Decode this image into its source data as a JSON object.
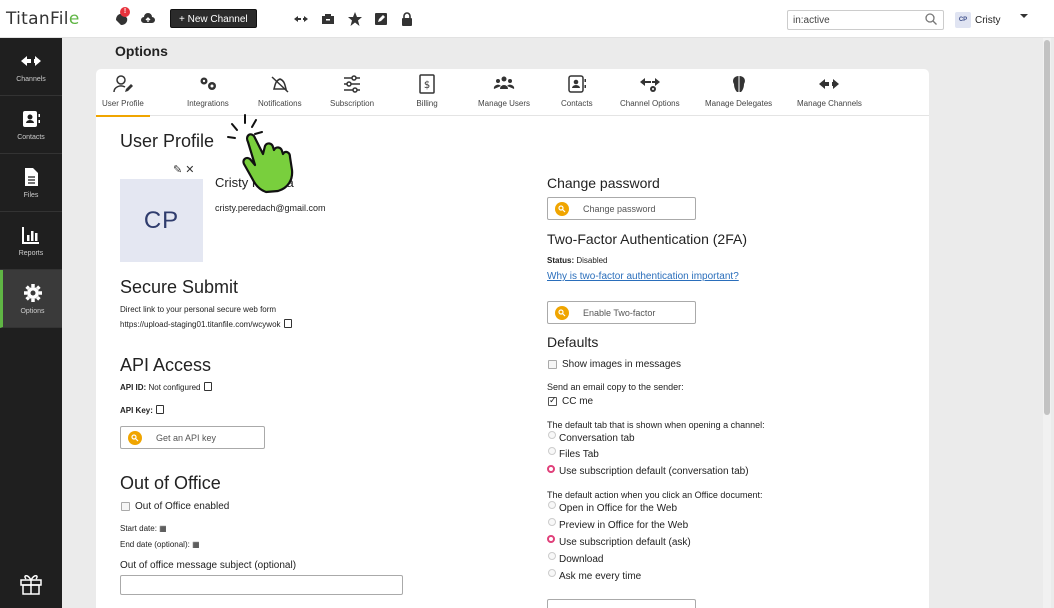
{
  "app": {
    "logo_main": "TitanFil",
    "logo_accent": "e"
  },
  "topbar": {
    "notification_count": "!",
    "new_channel_label": "+ New Channel",
    "search_value": "in:active",
    "user_initials": "CP",
    "user_name": "Cristy"
  },
  "leftnav": {
    "items": [
      {
        "label": "Channels",
        "icon": "arrows-icon"
      },
      {
        "label": "Contacts",
        "icon": "contact-card-icon"
      },
      {
        "label": "Files",
        "icon": "file-icon"
      },
      {
        "label": "Reports",
        "icon": "bar-chart-icon"
      },
      {
        "label": "Options",
        "icon": "gear-icon"
      }
    ],
    "active": "Options"
  },
  "page": {
    "title": "Options"
  },
  "tabs": [
    {
      "label": "User Profile",
      "icon": "user-edit-icon",
      "active": true
    },
    {
      "label": "Integrations",
      "icon": "gears-icon"
    },
    {
      "label": "Notifications",
      "icon": "bell-off-icon"
    },
    {
      "label": "Subscription",
      "icon": "sliders-icon"
    },
    {
      "label": "Billing",
      "icon": "dollar-doc-icon"
    },
    {
      "label": "Manage Users",
      "icon": "users-icon"
    },
    {
      "label": "Contacts",
      "icon": "contact-card-icon"
    },
    {
      "label": "Channel Options",
      "icon": "arrows-gear-icon"
    },
    {
      "label": "Manage Delegates",
      "icon": "heads-icon"
    },
    {
      "label": "Manage Channels",
      "icon": "arrows-icon"
    }
  ],
  "profile": {
    "heading": "User Profile",
    "avatar_initials": "CP",
    "edit_symbol": "✎ ✕",
    "name": "Cristy Pereda",
    "email": "cristy.peredach@gmail.com"
  },
  "secure_submit": {
    "heading": "Secure Submit",
    "description": "Direct link to your personal secure web form",
    "link": "https://upload-staging01.titanfile.com/wcywok"
  },
  "api": {
    "heading": "API Access",
    "id_label": "API ID:",
    "id_value": "Not configured",
    "key_label": "API Key:",
    "get_key_button": "Get an API key"
  },
  "out_of_office": {
    "heading": "Out of Office",
    "enabled_label": "Out of Office enabled",
    "start_label": "Start date:",
    "end_label": "End date (optional):",
    "subject_label": "Out of office message subject (optional)"
  },
  "password": {
    "heading": "Change password",
    "button": "Change password"
  },
  "two_factor": {
    "heading": "Two-Factor Authentication (2FA)",
    "status_label": "Status:",
    "status_value": "Disabled",
    "why_link": "Why is two-factor authentication important?",
    "button": "Enable Two-factor"
  },
  "defaults": {
    "heading": "Defaults",
    "show_images": "Show images in messages",
    "email_copy_label": "Send an email copy to the sender:",
    "cc_me": "CC me",
    "default_tab_label": "The default tab that is shown when opening a channel:",
    "tab_options": [
      "Conversation tab",
      "Files Tab",
      "Use subscription default (conversation tab)"
    ],
    "office_action_label": "The default action when you click an Office document:",
    "office_options": [
      "Open in Office for the Web",
      "Preview in Office for the Web",
      "Use subscription default (ask)",
      "Download",
      "Ask me every time"
    ]
  },
  "colors": {
    "accent_green": "#5fb544",
    "key_orange": "#f0a500",
    "radio_pink": "#e0407a"
  }
}
